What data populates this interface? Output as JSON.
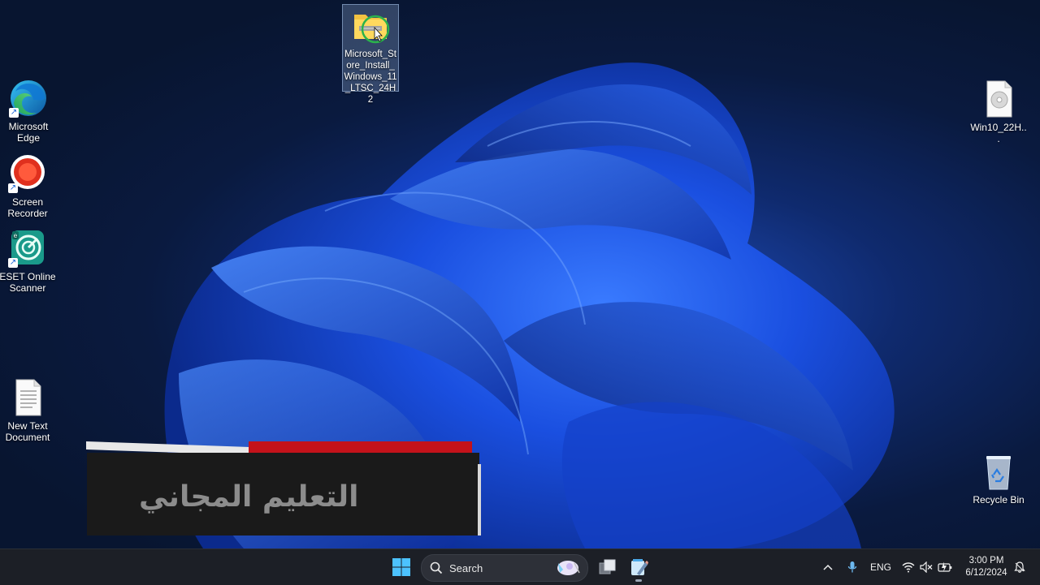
{
  "desktop": {
    "icons": [
      {
        "label": "Microsoft Edge",
        "icon": "edge-icon"
      },
      {
        "label": "Screen Recorder",
        "icon": "screen-recorder-icon"
      },
      {
        "label": "ESET Online Scanner",
        "icon": "eset-scanner-icon"
      },
      {
        "label": "New Text Document",
        "icon": "text-document-icon"
      },
      {
        "label": "Microsoft_Store_Install_Windows_11_LTSC_24H2",
        "icon": "zip-folder-icon"
      },
      {
        "label": "Win10_22H...",
        "icon": "disc-image-icon"
      },
      {
        "label": "Recycle Bin",
        "icon": "recycle-bin-icon"
      }
    ]
  },
  "banner": {
    "text": "التعليم المجاني"
  },
  "taskbar": {
    "search_placeholder": "Search",
    "tray": {
      "language": "ENG"
    },
    "clock": {
      "time": "3:00 PM",
      "date": "6/12/2024"
    }
  },
  "colors": {
    "accent": "#1f6fe0",
    "taskbar_bg": "#1c1f26",
    "banner_red": "#c4121a"
  }
}
